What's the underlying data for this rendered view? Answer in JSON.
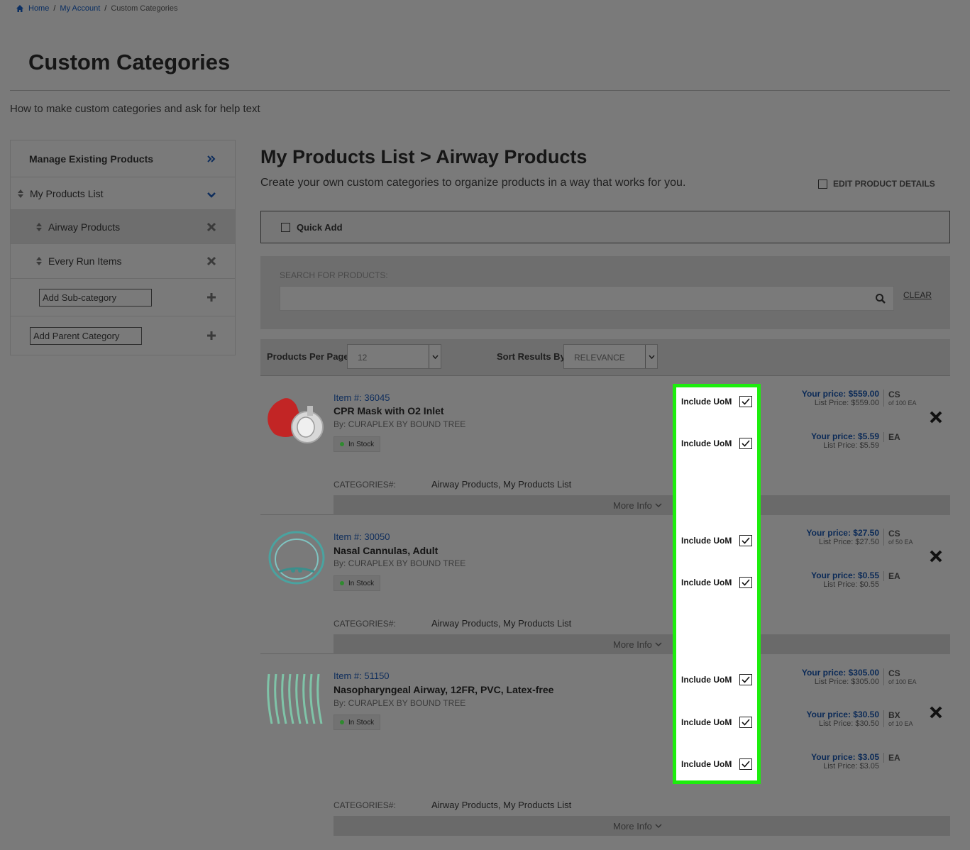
{
  "breadcrumb": {
    "home": "Home",
    "account": "My Account",
    "current": "Custom Categories",
    "sep": "/"
  },
  "page": {
    "title": "Custom Categories",
    "help_text": "How to make custom categories and ask for help text"
  },
  "sidebar": {
    "manage": "Manage Existing Products",
    "list_label": "My Products List",
    "items": [
      {
        "label": "Airway Products"
      },
      {
        "label": "Every Run Items"
      }
    ],
    "add_sub_placeholder": "Add Sub-category",
    "add_parent_placeholder": "Add Parent Category"
  },
  "main": {
    "title": "My Products List > Airway Products",
    "subtitle": "Create your own custom categories to organize products in a way that works for you.",
    "edit_details": "EDIT PRODUCT DETAILS",
    "quick_add": "Quick Add",
    "search_label": "SEARCH FOR PRODUCTS:",
    "clear": "CLEAR",
    "per_page_label": "Products Per Page:",
    "per_page_value": "12",
    "sort_label": "Sort Results By:",
    "sort_value": "RELEVANCE"
  },
  "products": [
    {
      "item": "Item #: 36045",
      "name": "CPR Mask with O2 Inlet",
      "brand": "By: CURAPLEX BY BOUND TREE",
      "stock": "In Stock",
      "cats_label": "CATEGORIES#:",
      "cats": "Airway Products, My Products List",
      "more": "More Info",
      "prices": [
        {
          "your": "Your price: $559.00",
          "list": "List Price: $559.00",
          "uom": "CS",
          "sub": "of 100 EA"
        },
        {
          "your": "Your price: $5.59",
          "list": "List Price: $5.59",
          "uom": "EA",
          "sub": ""
        }
      ]
    },
    {
      "item": "Item #: 30050",
      "name": "Nasal Cannulas, Adult",
      "brand": "By: CURAPLEX BY BOUND TREE",
      "stock": "In Stock",
      "cats_label": "CATEGORIES#:",
      "cats": "Airway Products, My Products List",
      "more": "More Info",
      "prices": [
        {
          "your": "Your price: $27.50",
          "list": "List Price: $27.50",
          "uom": "CS",
          "sub": "of 50 EA"
        },
        {
          "your": "Your price: $0.55",
          "list": "List Price: $0.55",
          "uom": "EA",
          "sub": ""
        }
      ]
    },
    {
      "item": "Item #: 51150",
      "name": "Nasopharyngeal Airway, 12FR, PVC, Latex-free",
      "brand": "By: CURAPLEX BY BOUND TREE",
      "stock": "In Stock",
      "cats_label": "CATEGORIES#:",
      "cats": "Airway Products, My Products List",
      "more": "More Info",
      "prices": [
        {
          "your": "Your price: $305.00",
          "list": "List Price: $305.00",
          "uom": "CS",
          "sub": "of 100 EA"
        },
        {
          "your": "Your price: $30.50",
          "list": "List Price: $30.50",
          "uom": "BX",
          "sub": "of 10 EA"
        },
        {
          "your": "Your price: $3.05",
          "list": "List Price: $3.05",
          "uom": "EA",
          "sub": ""
        }
      ]
    }
  ],
  "include_uom_label": "Include UoM",
  "colors": {
    "highlight": "#1ded0d",
    "link": "#0b2f63",
    "in_stock": "#2f8a2f"
  }
}
